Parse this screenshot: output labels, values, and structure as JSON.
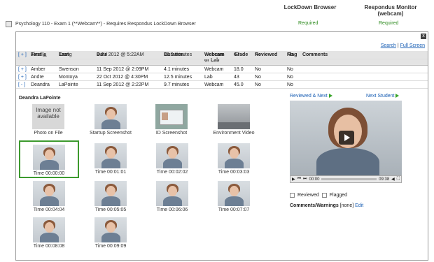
{
  "header": {
    "lockdown_col": "LockDown Browser",
    "monitor_col": "Respondus Monitor (webcam)",
    "exam_title": "Psychology 110 - Exam 1 (**Webcam**) - Requires Respondus LockDown Browser",
    "lockdown_status": "Required",
    "monitor_status": "Required"
  },
  "panel": {
    "close_label": "x",
    "search_link": "Search",
    "separator": " | ",
    "fullscreen_link": "Full Screen"
  },
  "table": {
    "columns": [
      "",
      "First",
      "Last",
      "Date",
      "Duration",
      "Webcam or Lab",
      "Grade",
      "Reviewed",
      "Flag",
      "Comments"
    ],
    "rows": [
      {
        "expander": "[ + ]",
        "first": "Amber",
        "last": "Swenson",
        "date": "11 Sep 2012 @ 2:09PM",
        "duration": "4.1 minutes",
        "webcam": "Webcam",
        "grade": "18.0",
        "reviewed": "No",
        "flag": "No",
        "comments": ""
      },
      {
        "expander": "[ + ]",
        "first": "Andre",
        "last": "Montoya",
        "date": "22 Oct 2012 @ 4:30PM",
        "duration": "12.5 minutes",
        "webcam": "Lab",
        "grade": "43",
        "reviewed": "No",
        "flag": "No",
        "comments": ""
      },
      {
        "expander": "[ - ]",
        "first": "Deandra",
        "last": "LaPointe",
        "date": "11 Sep 2012 @ 2:22PM",
        "duration": "9.7 minutes",
        "webcam": "Webcam",
        "grade": "45.0",
        "reviewed": "No",
        "flag": "No",
        "comments": ""
      }
    ],
    "last_row": {
      "expander": "[ + ]",
      "first": "Janelle",
      "last": "Tsang",
      "date": "3 Jul 2012 @ 5:22AM",
      "duration": "12.0 minutes",
      "webcam": "Webcam",
      "grade": "47",
      "reviewed": "No",
      "flag": "No",
      "comments": ""
    }
  },
  "detail": {
    "student_name": "Deandra LaPointe",
    "thumbnails": {
      "photo_on_file": "Photo on File",
      "no_image": "Image not available",
      "startup": "Startup Screenshot",
      "id_screenshot": "ID Screenshot",
      "environment": "Environment Video",
      "t0": "Time 00:00:00",
      "t1": "Time 00:01:01",
      "t2": "Time 00:02:02",
      "t3": "Time 00:03:03",
      "t4": "Time 00:04:04",
      "t5": "Time 00:05:05",
      "t6": "Time 00:06:06",
      "t7": "Time 00:07:07",
      "t8": "Time 00:08:08",
      "t9": "Time 00:09:09"
    },
    "reviewed_next": "Reviewed & Next",
    "next_student": "Next Student",
    "player": {
      "current_time": "00:00",
      "total_time": "09:38",
      "progress": 0
    },
    "reviewed_label": "Reviewed",
    "flagged_label": "Flagged",
    "comments_label": "Comments/Warnings",
    "comments_value": "[none]",
    "edit_link": "Edit"
  }
}
